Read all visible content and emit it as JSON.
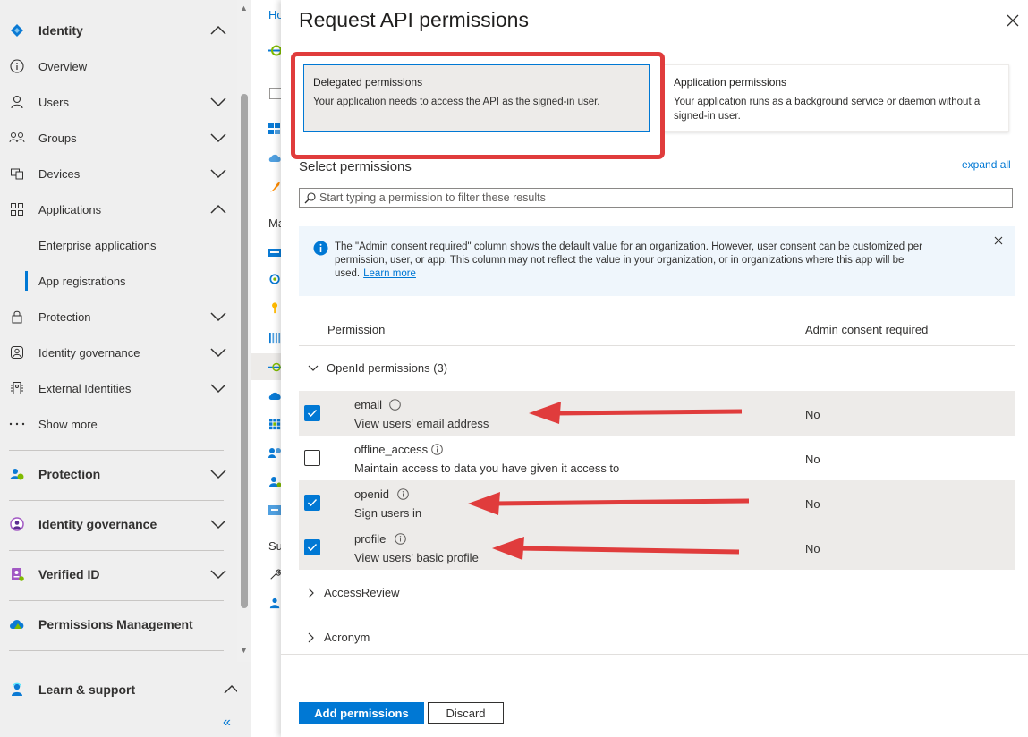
{
  "sidebar": {
    "items": [
      {
        "label": "Identity",
        "icon": "identity-diamond-icon",
        "chevron": "up"
      },
      {
        "label": "Overview",
        "icon": "info-circle-icon"
      },
      {
        "label": "Users",
        "icon": "person-icon",
        "chevron": "down"
      },
      {
        "label": "Groups",
        "icon": "people-icon",
        "chevron": "down"
      },
      {
        "label": "Devices",
        "icon": "devices-icon",
        "chevron": "down"
      },
      {
        "label": "Applications",
        "icon": "apps-grid-icon",
        "chevron": "up"
      },
      {
        "label": "Enterprise applications"
      },
      {
        "label": "App registrations"
      },
      {
        "label": "Protection",
        "icon": "lock-icon",
        "chevron": "down"
      },
      {
        "label": "Identity governance",
        "icon": "governance-icon",
        "chevron": "down"
      },
      {
        "label": "External Identities",
        "icon": "external-identities-icon",
        "chevron": "down"
      },
      {
        "label": "Show more",
        "icon": "ellipsis-icon"
      }
    ],
    "sections": [
      {
        "label": "Protection",
        "icon": "protection-people-icon"
      },
      {
        "label": "Identity governance",
        "icon": "governance-circle-icon"
      },
      {
        "label": "Verified ID",
        "icon": "verified-id-icon"
      },
      {
        "label": "Permissions Management",
        "icon": "cloud-permissions-icon"
      },
      {
        "label": "Learn & support",
        "icon": "support-person-icon"
      }
    ],
    "collapse_glyph": "«"
  },
  "middle": {
    "breadcrumb": "Ho",
    "section_manage": "Ma",
    "section_support": "Su"
  },
  "panel": {
    "title": "Request API permissions",
    "delegated": {
      "title": "Delegated permissions",
      "desc": "Your application needs to access the API as the signed-in user."
    },
    "application": {
      "title": "Application permissions",
      "desc": "Your application runs as a background service or daemon without a signed-in user."
    },
    "select_label": "Select permissions",
    "expand_all": "expand all",
    "filter_placeholder": "Start typing a permission to filter these results",
    "info_text": "The \"Admin consent required\" column shows the default value for an organization. However, user consent can be customized per permission, user, or app. This column may not reflect the value in your organization, or in organizations where this app will be used.",
    "info_link": "Learn more",
    "col_permission": "Permission",
    "col_admin": "Admin consent required",
    "group_openid": "OpenId permissions (3)",
    "permissions": [
      {
        "name": "email",
        "desc": "View users' email address",
        "admin": "No",
        "checked": true
      },
      {
        "name": "offline_access",
        "desc": "Maintain access to data you have given it access to",
        "admin": "No",
        "checked": false
      },
      {
        "name": "openid",
        "desc": "Sign users in",
        "admin": "No",
        "checked": true
      },
      {
        "name": "profile",
        "desc": "View users' basic profile",
        "admin": "No",
        "checked": true
      }
    ],
    "group_access_review": "AccessReview",
    "group_acronym": "Acronym",
    "add_button": "Add permissions",
    "discard_button": "Discard"
  },
  "colors": {
    "accent": "#0078d4",
    "annotation_red": "#e03c3c"
  }
}
